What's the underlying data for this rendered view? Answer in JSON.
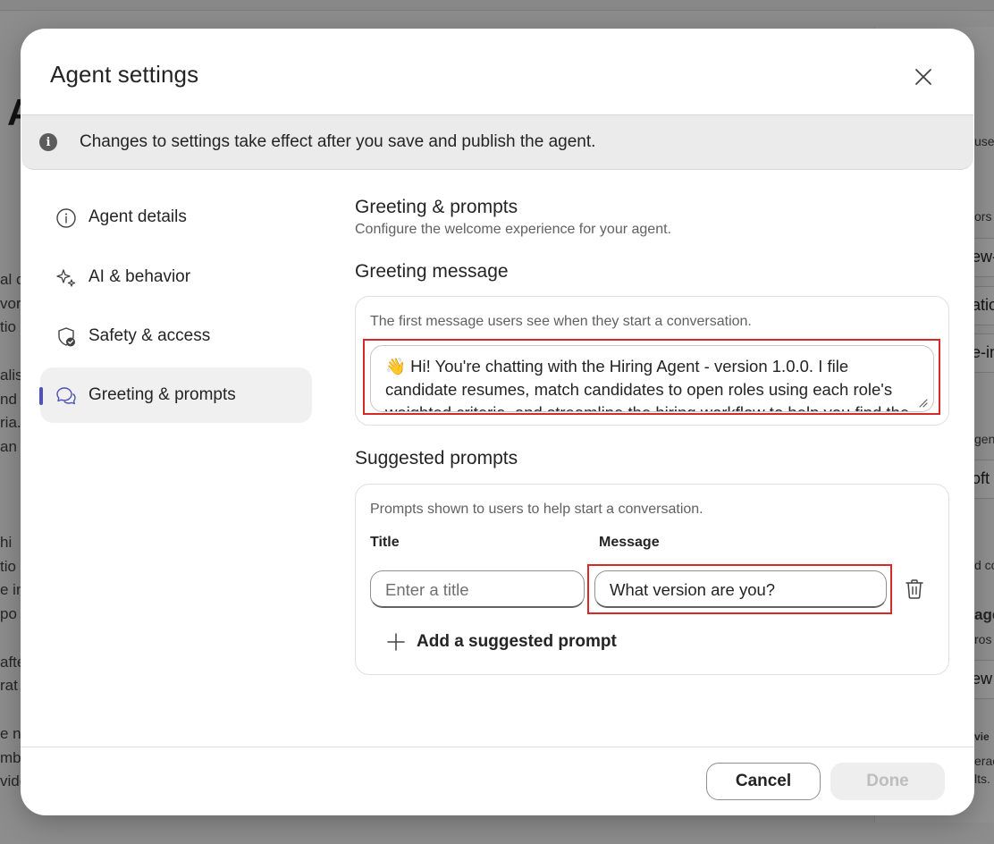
{
  "background": {
    "fragments_left": [
      "al c",
      "vor",
      "tio",
      "alis",
      "nd a",
      "ria.",
      " an",
      " hi",
      "tio",
      "e in",
      "po",
      "afte",
      "rat",
      "e n",
      "mbe",
      "vide"
    ],
    "fragments_right": [
      "use",
      "ors",
      "ew-",
      "atio",
      "e-in",
      "gen",
      "oft",
      "d co",
      "age",
      "ros",
      "ew",
      "vie",
      "erac",
      "lts."
    ],
    "big_letter": "A"
  },
  "dialog": {
    "title": "Agent settings",
    "close_label": "Close",
    "banner_text": "Changes to settings take effect after you save and publish the agent.",
    "nav": [
      {
        "label": "Agent details",
        "icon": "info-icon",
        "active": false
      },
      {
        "label": "AI & behavior",
        "icon": "sparkle-icon",
        "active": false
      },
      {
        "label": "Safety & access",
        "icon": "shield-check-icon",
        "active": false
      },
      {
        "label": "Greeting & prompts",
        "icon": "chat-bubbles-icon",
        "active": true
      }
    ],
    "content": {
      "title": "Greeting & prompts",
      "subtitle": "Configure the welcome experience for your agent.",
      "greeting": {
        "heading": "Greeting message",
        "hint": "The first message users see when they start a conversation.",
        "value": "👋 Hi! You're chatting with the Hiring Agent - version 1.0.0. I file candidate resumes, match candidates to open roles using each role's weighted criteria, and streamline the hiring workflow to help you find the right fit."
      },
      "prompts": {
        "heading": "Suggested prompts",
        "hint": "Prompts shown to users to help start a conversation.",
        "title_col": "Title",
        "message_col": "Message",
        "rows": [
          {
            "title_placeholder": "Enter a title",
            "title_value": "",
            "message_value": "What version are you?"
          }
        ],
        "add_label": "Add a suggested prompt"
      }
    },
    "footer": {
      "cancel_label": "Cancel",
      "done_label": "Done"
    }
  },
  "colors": {
    "accent": "#4f52b2",
    "highlight_border": "#d62a2a",
    "disabled_text": "#bdbdbd"
  }
}
